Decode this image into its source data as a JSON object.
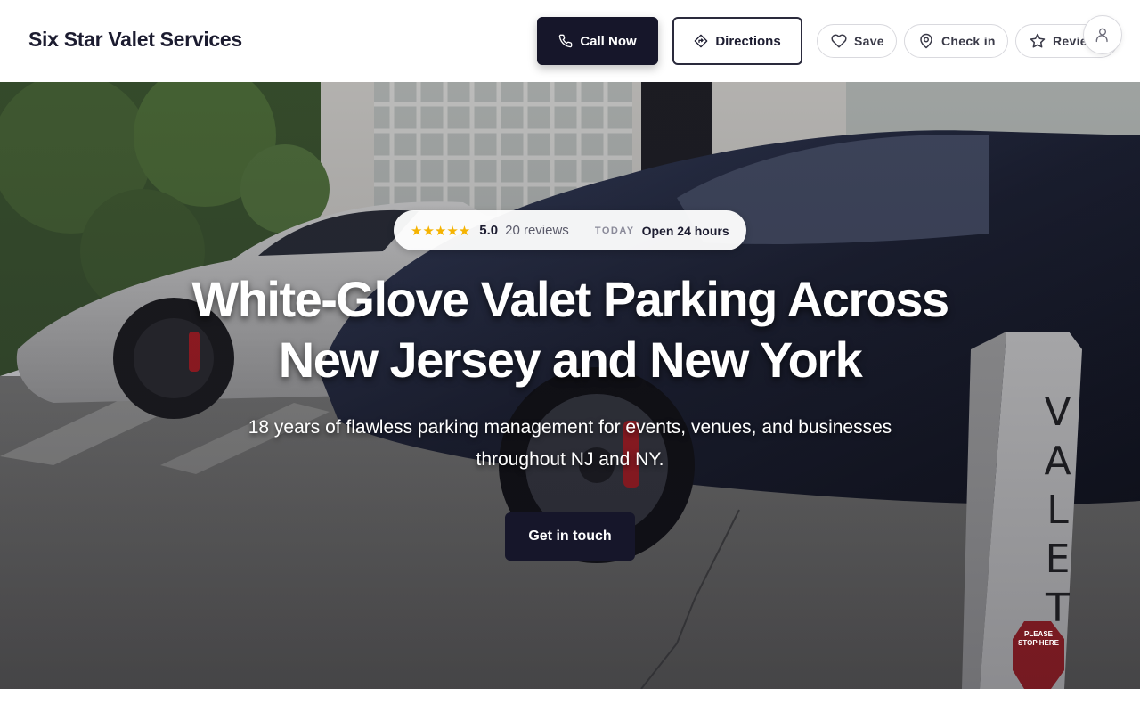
{
  "header": {
    "brand": "Six Star Valet Services",
    "call_label": "Call Now",
    "directions_label": "Directions",
    "save_label": "Save",
    "checkin_label": "Check in",
    "review_label": "Review"
  },
  "hero": {
    "stars": "★★★★★",
    "rating": "5.0",
    "reviews": "20 reviews",
    "today_label": "TODAY",
    "hours": "Open 24 hours",
    "headline_line1": "White-Glove Valet Parking Across",
    "headline_line2": "New Jersey and New York",
    "subhead_line1": "18 years of flawless parking management for events, venues, and businesses",
    "subhead_line2": "throughout NJ and NY.",
    "cta_label": "Get in touch",
    "sign_text": "VALET",
    "stop_sign_text": "PLEASE STOP HERE"
  },
  "colors": {
    "primary_dark": "#16162a",
    "star": "#f5b301",
    "white": "#ffffff"
  },
  "icons": {
    "call": "phone-icon",
    "directions": "directions-icon",
    "save": "heart-icon",
    "checkin": "map-pin-icon",
    "review": "star-icon",
    "account": "user-icon"
  }
}
